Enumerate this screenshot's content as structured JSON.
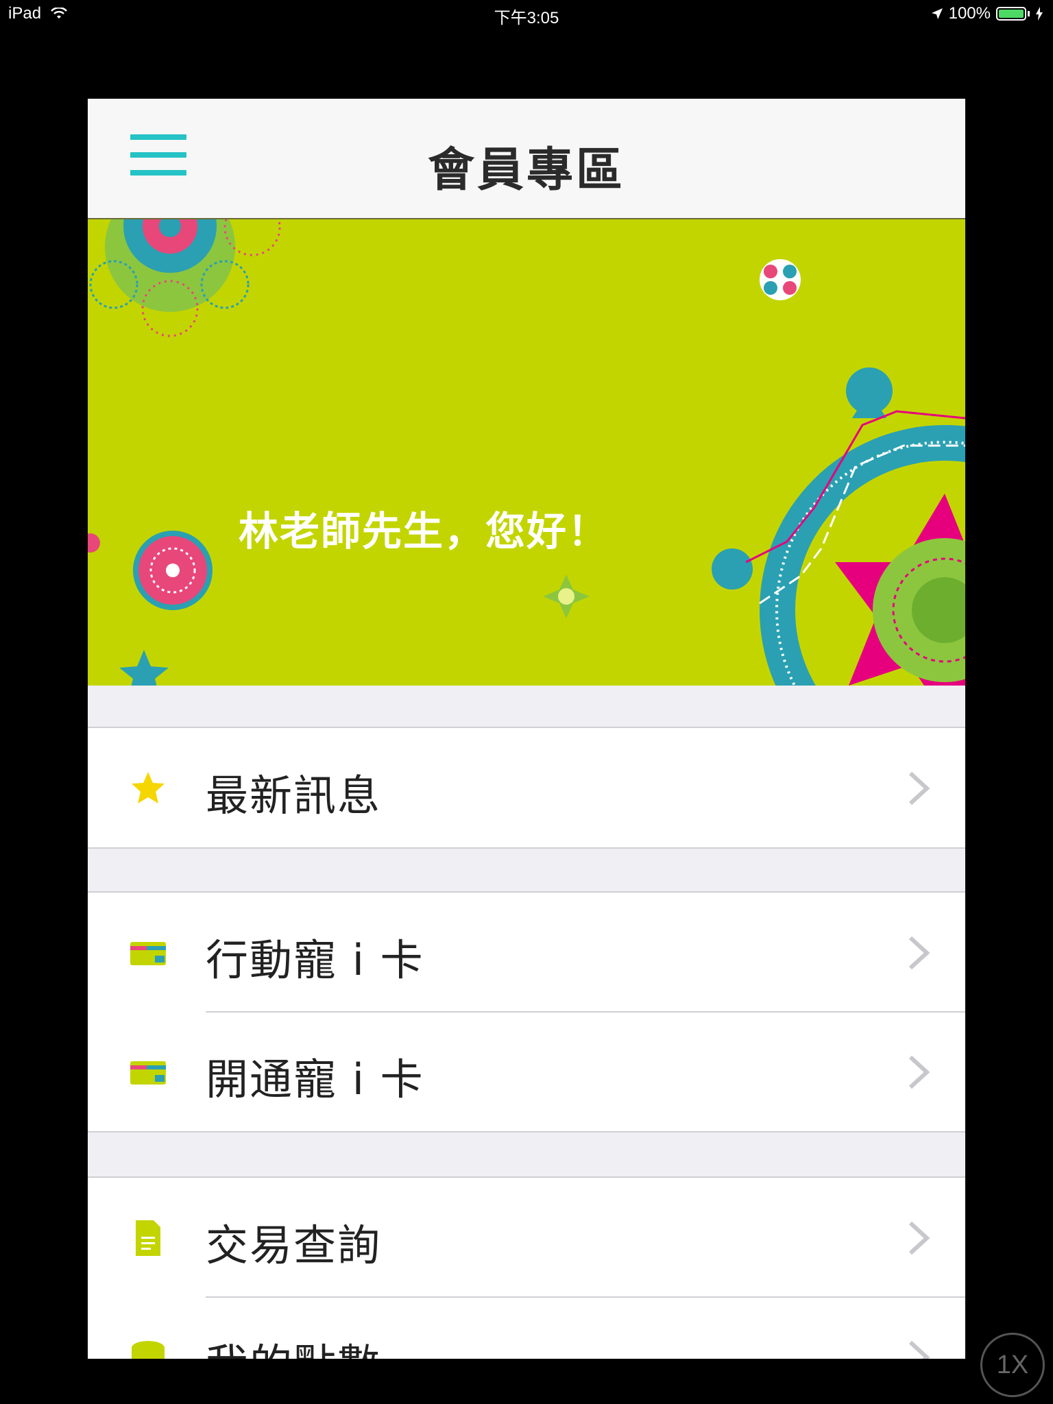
{
  "status_bar": {
    "device": "iPad",
    "time": "下午3:05",
    "battery_percent": "100%",
    "battery_level": 1.0
  },
  "nav": {
    "title": "會員專區",
    "menu_icon": "hamburger-icon"
  },
  "banner": {
    "greeting": "林老師先生，您好！"
  },
  "groups": [
    {
      "items": [
        {
          "label": "最新訊息",
          "icon": "star-icon"
        }
      ]
    },
    {
      "items": [
        {
          "label": "行動寵 i 卡",
          "icon": "card-icon"
        },
        {
          "label": "開通寵 i 卡",
          "icon": "card-icon"
        }
      ]
    },
    {
      "items": [
        {
          "label": "交易查詢",
          "icon": "document-icon"
        },
        {
          "label": "我的點數",
          "icon": "coins-icon"
        }
      ]
    }
  ],
  "colors": {
    "accent": "#25c2c6",
    "banner": "#c3d500",
    "icon_green": "#c3d500"
  },
  "zoom_button": {
    "label": "1X"
  }
}
